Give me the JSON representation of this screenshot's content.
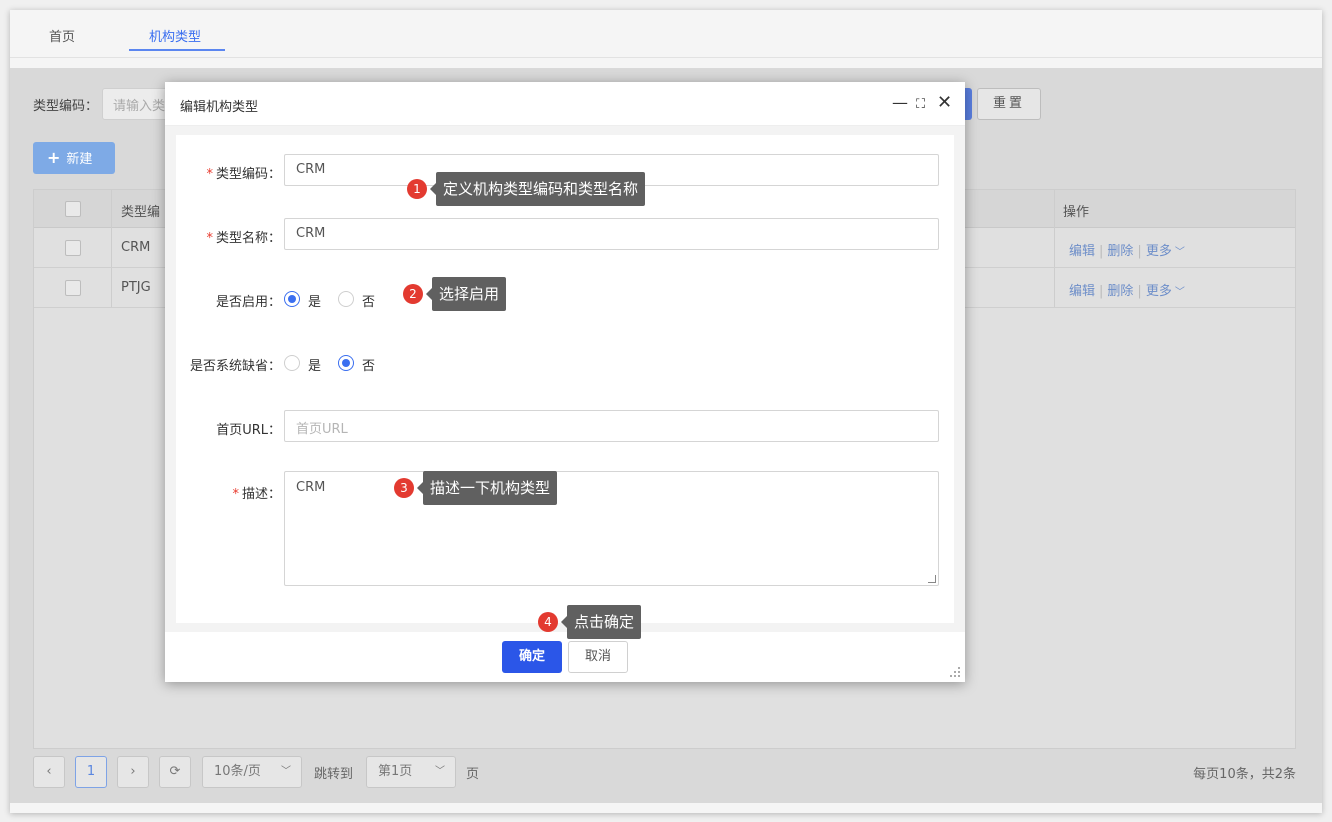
{
  "tabs": [
    {
      "label": "首页"
    },
    {
      "label": "机构类型"
    }
  ],
  "search": {
    "type_code_label": "类型编码：",
    "type_code_placeholder": "请输入类",
    "reset_label": "重置"
  },
  "toolbar": {
    "new_label": "新建"
  },
  "table": {
    "headers": {
      "type_code": "类型编",
      "operation": "操作"
    },
    "rows": [
      {
        "code": "CRM",
        "edit": "编辑",
        "delete": "删除",
        "more": "更多"
      },
      {
        "code": "PTJG",
        "edit": "编辑",
        "delete": "删除",
        "more": "更多"
      }
    ]
  },
  "pagination": {
    "current_page": "1",
    "page_size": "10条/页",
    "jump_label": "跳转到",
    "jump_value": "第1页",
    "page_suffix": "页",
    "summary": "每页10条，共2条"
  },
  "modal": {
    "title": "编辑机构类型",
    "fields": {
      "type_code": {
        "label": "类型编码：",
        "value": "CRM"
      },
      "type_name": {
        "label": "类型名称：",
        "value": "CRM"
      },
      "enabled": {
        "label": "是否启用：",
        "yes": "是",
        "no": "否",
        "selected": "是"
      },
      "system_default": {
        "label": "是否系统缺省：",
        "yes": "是",
        "no": "否",
        "selected": "否"
      },
      "homepage_url": {
        "label": "首页URL：",
        "placeholder": "首页URL",
        "value": ""
      },
      "description": {
        "label": "描述：",
        "value": "CRM"
      }
    },
    "ok_label": "确定",
    "cancel_label": "取消"
  },
  "annotations": [
    {
      "num": "1",
      "text": "定义机构类型编码和类型名称"
    },
    {
      "num": "2",
      "text": "选择启用"
    },
    {
      "num": "3",
      "text": "描述一下机构类型"
    },
    {
      "num": "4",
      "text": "点击确定"
    }
  ],
  "colors": {
    "primary": "#2b56e8",
    "required": "#e8382b",
    "annotation_badge": "#e33a30",
    "annotation_tip": "#606060"
  }
}
